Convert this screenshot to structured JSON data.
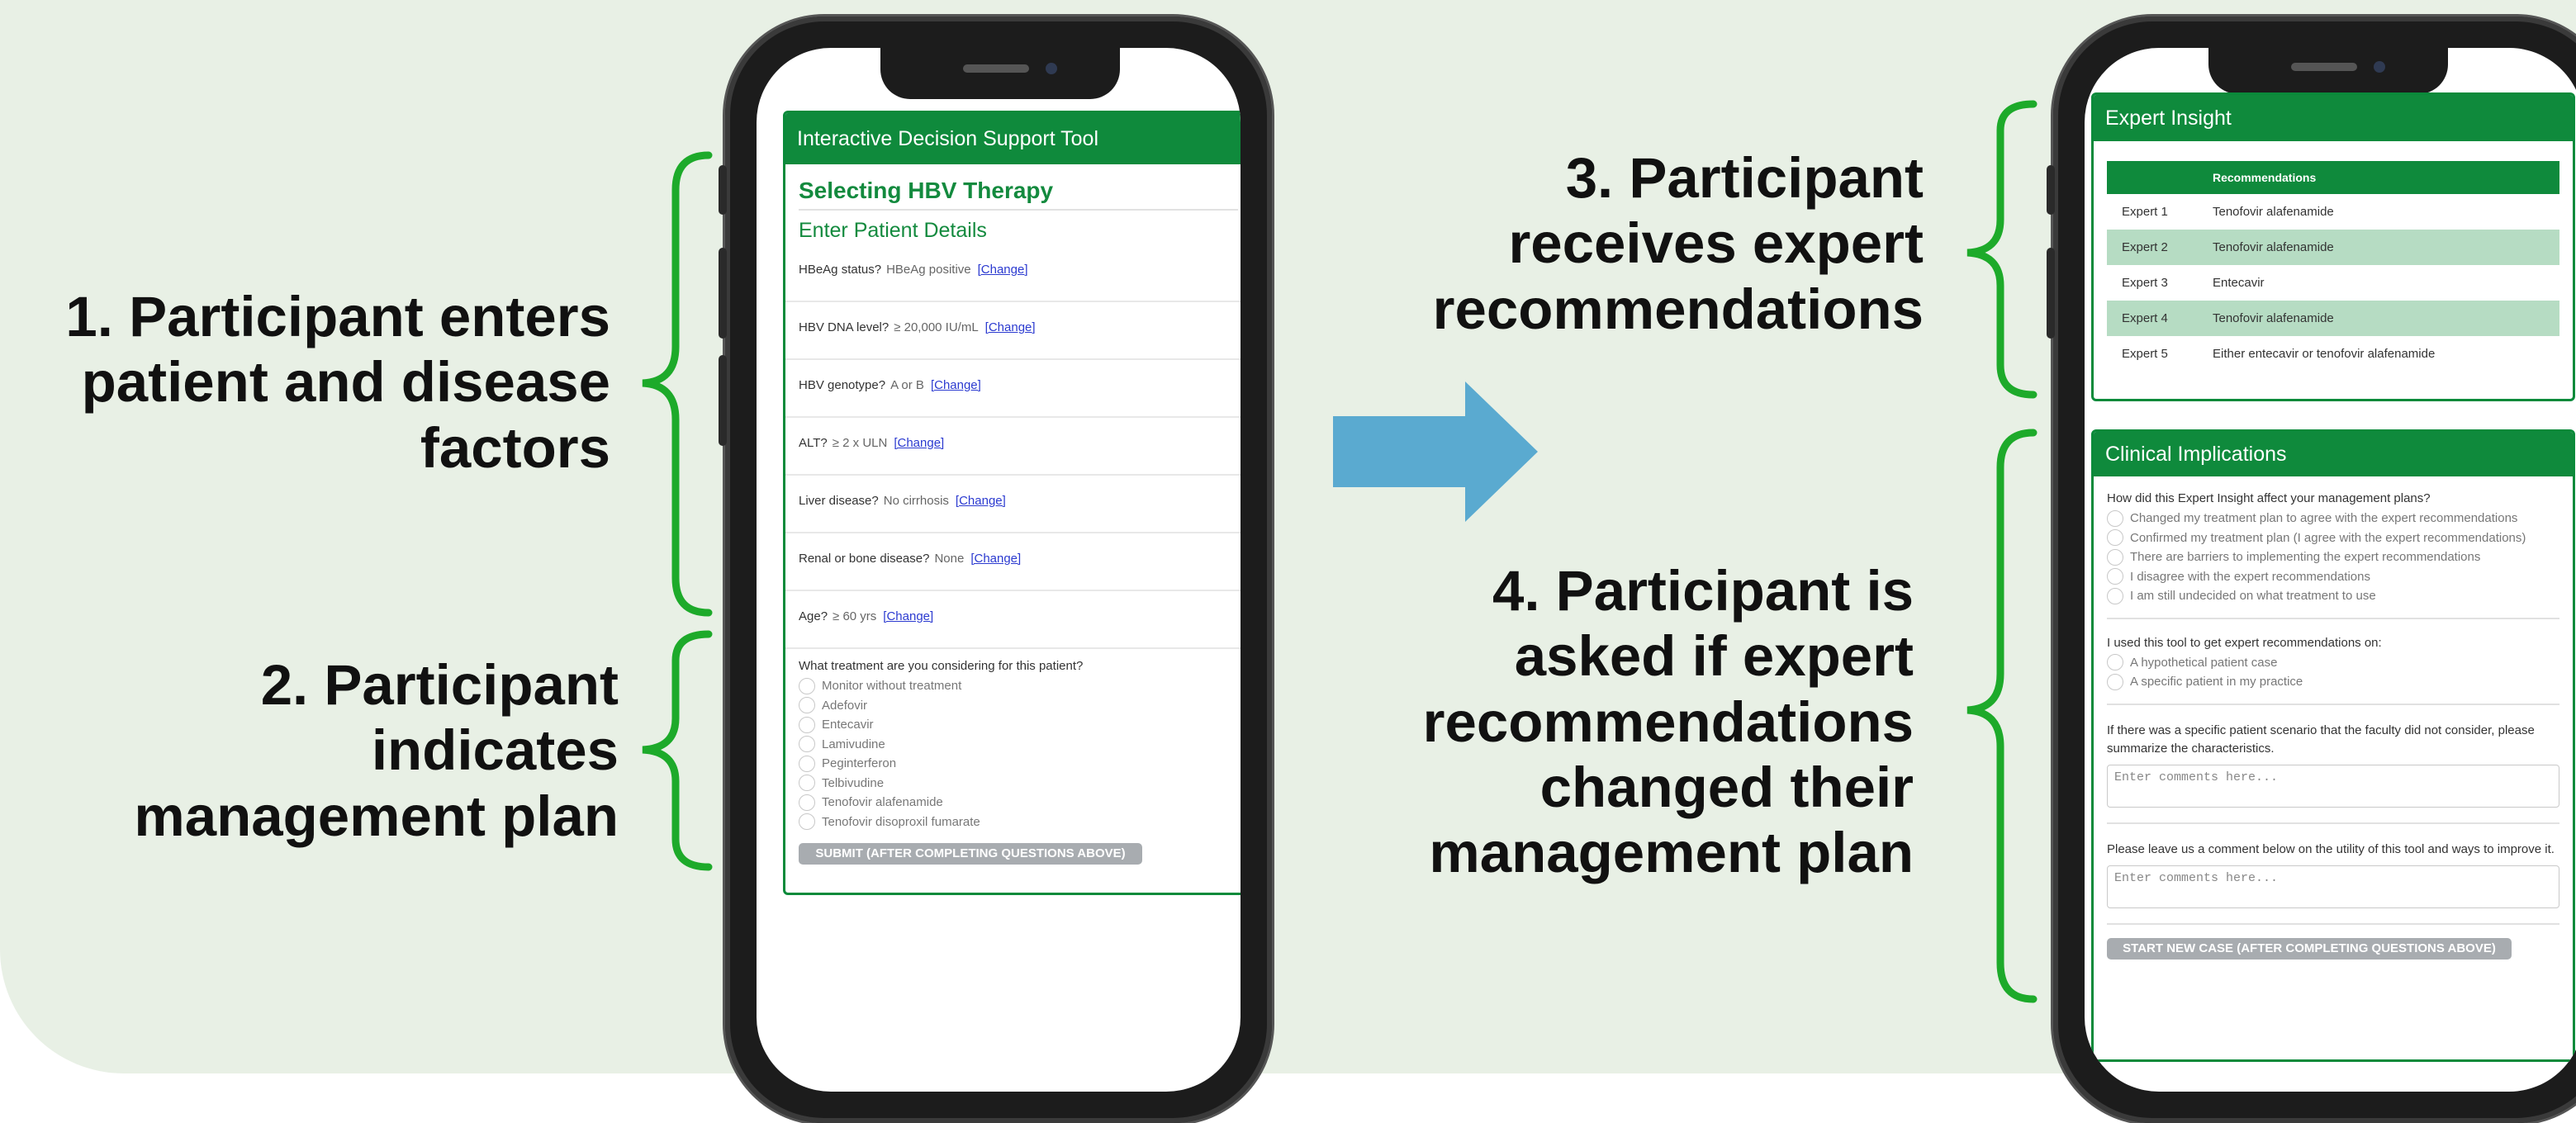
{
  "labels": {
    "step1": [
      "1. Participant enters",
      "patient and disease",
      "factors"
    ],
    "step2": [
      "2. Participant",
      "indicates",
      "management plan"
    ],
    "step3": [
      "3. Participant",
      "receives expert",
      "recommendations"
    ],
    "step4": [
      "4. Participant is",
      "asked if expert",
      "recommendations",
      "changed their",
      "management plan"
    ]
  },
  "colors": {
    "bracket": "#1daa2a",
    "arrow": "#5aaad0",
    "header": "#0f8a3c",
    "background": "#e8f0e5"
  },
  "left_app": {
    "header": "Interactive Decision Support Tool",
    "title": "Selecting HBV Therapy",
    "section": "Enter Patient Details",
    "change_label": "[Change]",
    "fields": [
      {
        "label": "HBeAg status?",
        "value": "HBeAg positive"
      },
      {
        "label": "HBV DNA level?",
        "value": "≥ 20,000 IU/mL"
      },
      {
        "label": "HBV genotype?",
        "value": "A or B"
      },
      {
        "label": "ALT?",
        "value": "≥ 2 x ULN"
      },
      {
        "label": "Liver disease?",
        "value": "No cirrhosis"
      },
      {
        "label": "Renal or bone disease?",
        "value": "None"
      },
      {
        "label": "Age?",
        "value": "≥ 60 yrs"
      }
    ],
    "question": "What treatment are you considering for this patient?",
    "options": [
      "Monitor without treatment",
      "Adefovir",
      "Entecavir",
      "Lamivudine",
      "Peginterferon",
      "Telbivudine",
      "Tenofovir alafenamide",
      "Tenofovir disoproxil fumarate"
    ],
    "submit": "SUBMIT (AFTER COMPLETING QUESTIONS ABOVE)"
  },
  "right_app": {
    "insight_header": "Expert Insight",
    "table_header": "Recommendations",
    "experts": [
      {
        "name": "Expert 1",
        "rec": "Tenofovir alafenamide"
      },
      {
        "name": "Expert 2",
        "rec": "Tenofovir alafenamide"
      },
      {
        "name": "Expert 3",
        "rec": "Entecavir"
      },
      {
        "name": "Expert 4",
        "rec": "Tenofovir alafenamide"
      },
      {
        "name": "Expert 5",
        "rec": "Either entecavir or tenofovir alafenamide"
      }
    ],
    "clinical_header": "Clinical Implications",
    "q1": "How did this Expert Insight affect your management plans?",
    "q1_options": [
      "Changed my treatment plan to agree with the expert recommendations",
      "Confirmed my treatment plan (I agree with the expert recommendations)",
      "There are barriers to implementing the expert recommendations",
      "I disagree with the expert recommendations",
      "I am still undecided on what treatment to use"
    ],
    "q2": "I used this tool to get expert recommendations on:",
    "q2_options": [
      "A hypothetical patient case",
      "A specific patient in my practice"
    ],
    "q3": "If there was a specific patient scenario that the faculty did not consider, please summarize the characteristics.",
    "q4": "Please leave us a comment below on the utility of this tool and ways to improve it.",
    "textarea_placeholder": "Enter comments here...",
    "start_new": "START NEW CASE (AFTER COMPLETING QUESTIONS ABOVE)"
  }
}
